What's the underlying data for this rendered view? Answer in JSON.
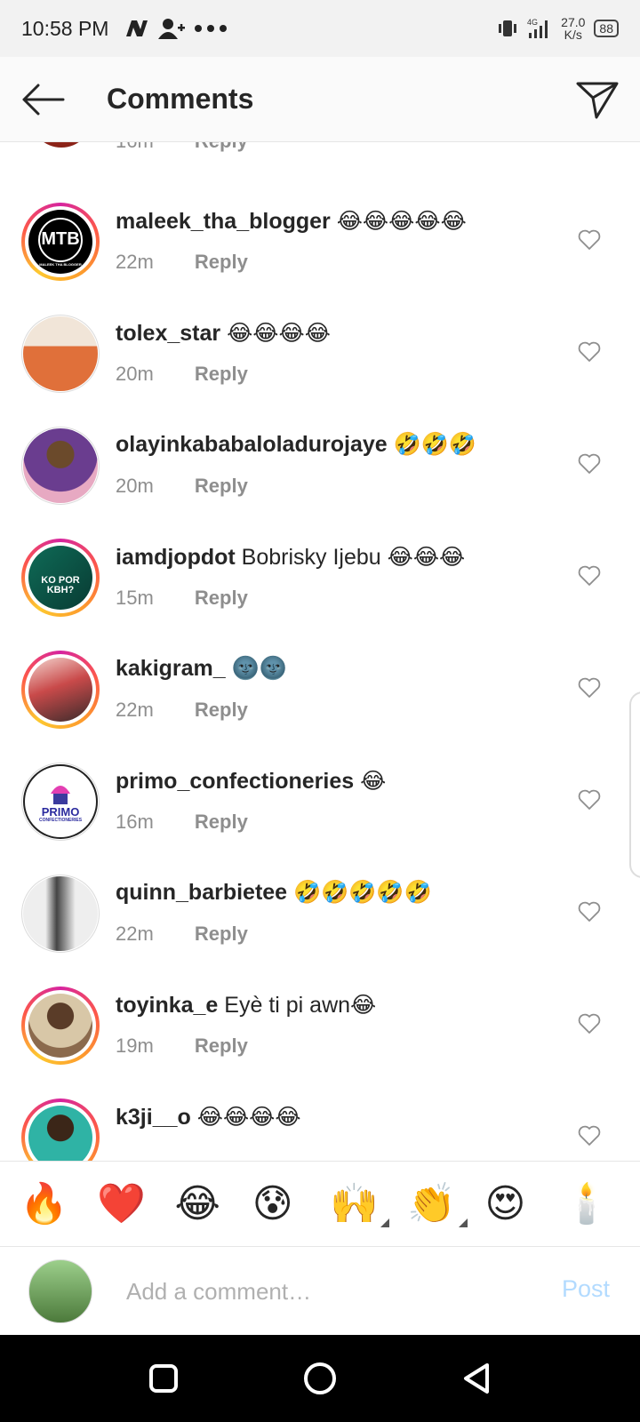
{
  "status_bar": {
    "time": "10:58 PM",
    "network_label": "4G",
    "speed_value": "27.0",
    "speed_unit": "K/s",
    "battery": "88"
  },
  "header": {
    "title": "Comments",
    "back_icon": "arrow-left-icon",
    "send_icon": "paper-plane-icon"
  },
  "partial_comment": {
    "time": "16m",
    "reply_label": "Reply"
  },
  "comments": [
    {
      "username": "maleek_tha_blogger",
      "text": "😂😂😂😂😂",
      "time": "22m",
      "reply_label": "Reply",
      "avatar_ring": true,
      "avatar_color": "#000000"
    },
    {
      "username": "tolex_star",
      "text": "😂😂😂😂",
      "time": "20m",
      "reply_label": "Reply",
      "avatar_ring": false,
      "avatar_color": "#e0703a"
    },
    {
      "username": "olayinkababaloladurojaye",
      "text": "🤣🤣🤣",
      "time": "20m",
      "reply_label": "Reply",
      "avatar_ring": false,
      "avatar_color": "#6a3d8f"
    },
    {
      "username": "iamdjopdot",
      "text": "Bobrisky Ijebu 😂😂😂",
      "time": "15m",
      "reply_label": "Reply",
      "avatar_ring": true,
      "avatar_color": "#0f6b57"
    },
    {
      "username": "kakigram_",
      "text": "🌚🌚",
      "time": "22m",
      "reply_label": "Reply",
      "avatar_ring": true,
      "avatar_color": "#c94a4a"
    },
    {
      "username": "primo_confectioneries",
      "text": "😂",
      "time": "16m",
      "reply_label": "Reply",
      "avatar_ring": false,
      "avatar_color": "#ffffff"
    },
    {
      "username": "quinn_barbietee",
      "text": "🤣🤣🤣🤣🤣",
      "time": "22m",
      "reply_label": "Reply",
      "avatar_ring": false,
      "avatar_color": "#9a9a9a"
    },
    {
      "username": "toyinka_e",
      "text": "Eyè ti pi awn😂",
      "time": "19m",
      "reply_label": "Reply",
      "avatar_ring": true,
      "avatar_color": "#8b6a4d"
    },
    {
      "username": "k3ji__o",
      "text": "😂😂😂😂",
      "time": "",
      "reply_label": "",
      "avatar_ring": true,
      "avatar_color": "#2fb3a5"
    }
  ],
  "avatar_texts": {
    "maleek_logo": "MTB",
    "maleek_caption": "MALEEK THA BLOGGER",
    "iamdjopdot_logo": "KO POR KBH?",
    "primo_logo": "PRIMO",
    "primo_caption": "CONFECTIONERIES"
  },
  "quick_emojis": [
    "🔥",
    "❤️",
    "😂",
    "😰",
    "🙌",
    "👏",
    "😍",
    "🕯️"
  ],
  "composer": {
    "placeholder": "Add a comment…",
    "post_label": "Post"
  },
  "colors": {
    "post_disabled": "#b3dbff",
    "meta_gray": "#8e8e8e"
  }
}
